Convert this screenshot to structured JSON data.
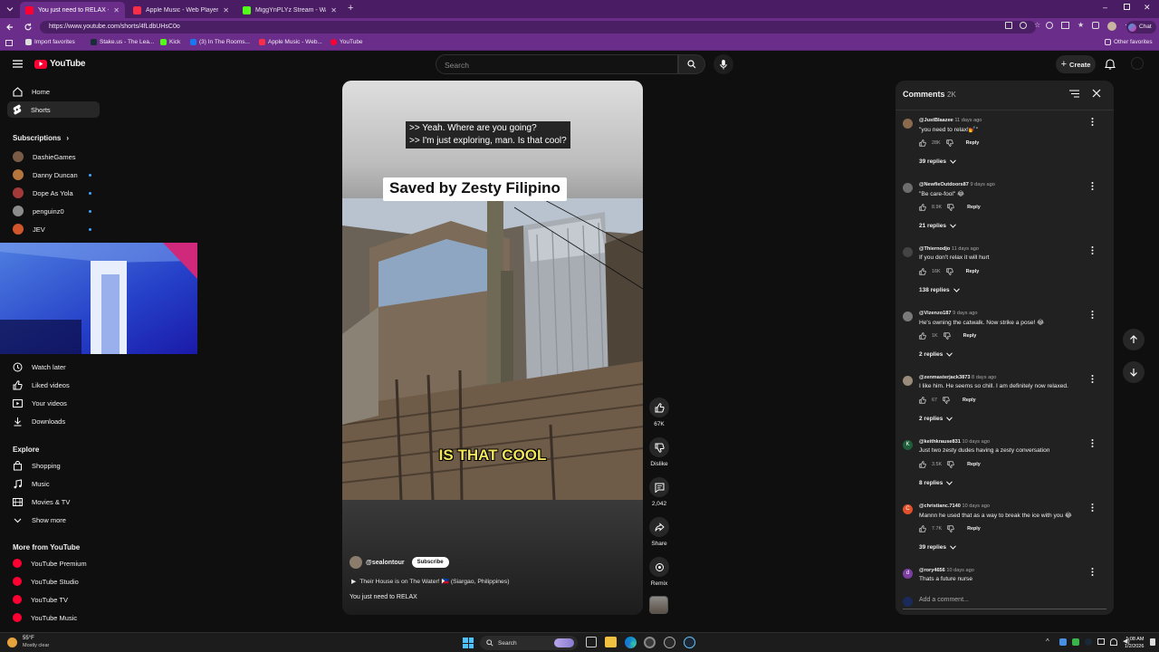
{
  "browser": {
    "tabs": [
      {
        "label": "You just need to RELAX - YouTub",
        "color": "#ff0033",
        "active": true
      },
      {
        "label": "Apple Music - Web Player",
        "color": "#fa2d48",
        "active": false
      },
      {
        "label": "MiggYnPLYz Stream - Watch Li",
        "color": "#53fc18",
        "active": false
      }
    ],
    "url": "https://www.youtube.com/shorts/4fLdbUHsC0o",
    "bookmarks": [
      {
        "label": "Import favorites",
        "color": "#dddddd"
      },
      {
        "label": "Stake.us - The Lea...",
        "color": "#1a2c38"
      },
      {
        "label": "Kick",
        "color": "#53fc18"
      },
      {
        "label": "(3) In The Rooms...",
        "color": "#1877f2"
      },
      {
        "label": "Apple Music - Web...",
        "color": "#fa2d48"
      },
      {
        "label": "YouTube",
        "color": "#ff0033"
      }
    ],
    "other_favorites": "Other favorites",
    "chat_label": "Chat"
  },
  "header": {
    "logo_text": "YouTube",
    "search_placeholder": "Search",
    "create_label": "Create"
  },
  "sidebar": {
    "main": [
      {
        "label": "Home",
        "icon": "home-icon",
        "active": false
      },
      {
        "label": "Shorts",
        "icon": "shorts-icon",
        "active": true
      }
    ],
    "subscriptions_title": "Subscriptions",
    "subscriptions": [
      {
        "name": "DashieGames",
        "color": "#7a5c46",
        "live": false
      },
      {
        "name": "Danny Duncan",
        "color": "#b5763d",
        "live": true
      },
      {
        "name": "Dope As Yola",
        "color": "#a33a3a",
        "live": true
      },
      {
        "name": "penguinz0",
        "color": "#8c8c8c",
        "live": true
      },
      {
        "name": "JEV",
        "color": "#d1562c",
        "live": true
      }
    ],
    "you": [
      {
        "label": "Watch later",
        "icon": "clock-icon"
      },
      {
        "label": "Liked videos",
        "icon": "thumb-up-icon"
      },
      {
        "label": "Your videos",
        "icon": "video-icon"
      },
      {
        "label": "Downloads",
        "icon": "download-icon"
      }
    ],
    "explore_title": "Explore",
    "explore": [
      {
        "label": "Shopping",
        "icon": "bag-icon"
      },
      {
        "label": "Music",
        "icon": "music-icon"
      },
      {
        "label": "Movies & TV",
        "icon": "film-icon"
      },
      {
        "label": "Show more",
        "icon": "chevron-down-icon"
      }
    ],
    "more_title": "More from YouTube",
    "more": [
      {
        "label": "YouTube Premium"
      },
      {
        "label": "YouTube Studio"
      },
      {
        "label": "YouTube TV"
      },
      {
        "label": "YouTube Music"
      }
    ]
  },
  "video": {
    "caption_line1": ">> Yeah. Where are you going?",
    "caption_line2": ">> I'm just exploring, man. Is that cool?",
    "banner": "Saved by Zesty Filipino",
    "overlay_text": "IS THAT COOL",
    "channel": "@sealontour",
    "subscribe": "Subscribe",
    "song": "Their House is on The Water! 🇵🇭 (Siargao, Philippines)",
    "title": "You just need to RELAX"
  },
  "actions": {
    "likes": "67K",
    "dislike": "Dislike",
    "comments": "2,042",
    "share": "Share",
    "remix": "Remix"
  },
  "comments": {
    "title": "Comments",
    "count": "2K",
    "add_placeholder": "Add a comment...",
    "items": [
      {
        "author": "@JustBlaazee",
        "time": "11 days ago",
        "text": "\"you need to relax!💅\"",
        "likes": "28K",
        "replies": "39 replies",
        "avatar_color": "#8a6a4e",
        "initial": ""
      },
      {
        "author": "@NewfieOutdoors87",
        "time": "9 days ago",
        "text": "\"Be care-fool\" 😂",
        "likes": "8.9K",
        "replies": "21 replies",
        "avatar_color": "#6d6d6d",
        "initial": ""
      },
      {
        "author": "@Thiernodjo",
        "time": "11 days ago",
        "text": "If you don't relax it will hurt",
        "likes": "16K",
        "replies": "138 replies",
        "avatar_color": "#444444",
        "initial": ""
      },
      {
        "author": "@Vizenzo187",
        "time": "9 days ago",
        "text": "He's owning the catwalk. Now strike a pose! 😂",
        "likes": "1K",
        "replies": "2 replies",
        "avatar_color": "#7a7a7a",
        "initial": ""
      },
      {
        "author": "@zenmasterjack3873",
        "time": "8 days ago",
        "text": "I like him. He seems so chill. I am definitely now relaxed.",
        "likes": "67",
        "replies": "2 replies",
        "avatar_color": "#9a8c7a",
        "initial": ""
      },
      {
        "author": "@keithkrause831",
        "time": "10 days ago",
        "text": "Just two zesty dudes having a zesty conversation",
        "likes": "3.5K",
        "replies": "8 replies",
        "avatar_color": "#1f5e3a",
        "initial": "K"
      },
      {
        "author": "@christianc.7140",
        "time": "10 days ago",
        "text": "Mannn he used that as a way to break the ice with you 😂",
        "likes": "7.7K",
        "replies": "39 replies",
        "avatar_color": "#e0502a",
        "initial": "C"
      },
      {
        "author": "@rory4656",
        "time": "10 days ago",
        "text": "Thats a future nurse",
        "likes": "",
        "replies": "",
        "avatar_color": "#7b3fa0",
        "initial": "d"
      }
    ],
    "reply_label": "Reply"
  },
  "taskbar": {
    "weather_temp": "55°F",
    "weather_cond": "Mostly clear",
    "search": "Search",
    "time": "1:08 AM",
    "date": "1/2/2026"
  }
}
